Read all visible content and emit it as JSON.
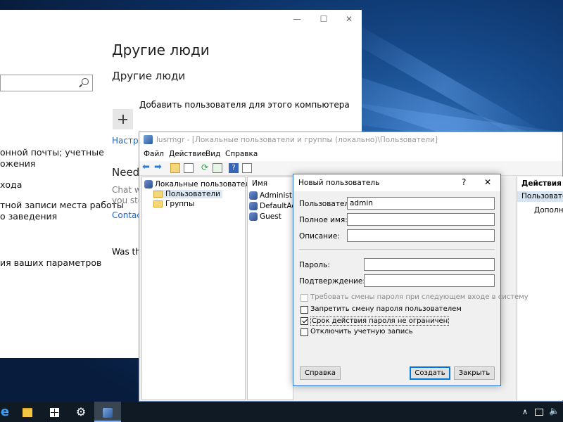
{
  "settings": {
    "heading": "Другие люди",
    "subheading": "Другие люди",
    "add_user_text": "Добавить пользователя для этого компьютера",
    "link_setup": "Настро",
    "need_heading": "Need",
    "chat_line1": "Chat w",
    "chat_line2": "you ste",
    "contact_link": "Contac",
    "was_this": "Was thi",
    "left_items": [
      "онной почты; учетные",
      "ожения",
      "хода",
      "тной записи места работы",
      "о заведения",
      "ия ваших параметров"
    ]
  },
  "lusrmgr": {
    "title": "lusrmgr - [Локальные пользователи и группы (локально)\\Пользователи]",
    "menu": [
      "Файл",
      "Действие",
      "Вид",
      "Справка"
    ],
    "tree_root": "Локальные пользователи и гру",
    "tree_users": "Пользователи",
    "tree_groups": "Группы",
    "list_header": "Имя",
    "list_items": [
      "Administrat",
      "DefaultAcc",
      "Guest"
    ],
    "actions_header": "Действия",
    "actions_selected": "Пользовател",
    "actions_more": "Дополни"
  },
  "dialog": {
    "title": "Новый пользователь",
    "help_glyph": "?",
    "close_glyph": "✕",
    "user_label": "Пользователь:",
    "user_value": "admin",
    "fullname_label": "Полное имя:",
    "description_label": "Описание:",
    "password_label": "Пароль:",
    "confirm_label": "Подтверждение:",
    "chk_require_change": "Требовать смены пароля при следующем входе в систему",
    "chk_forbid_change": "Запретить смену пароля пользователем",
    "chk_no_expire": "Срок действия пароля не ограничен",
    "chk_disable": "Отключить учетную запись",
    "chk_require_change_checked": false,
    "chk_forbid_change_checked": false,
    "chk_no_expire_checked": true,
    "chk_disable_checked": false,
    "btn_help": "Справка",
    "btn_create": "Создать",
    "btn_close": "Закрыть"
  },
  "taskbar": {
    "tray_chevron": "∧",
    "accent": "#8ab4f8"
  }
}
